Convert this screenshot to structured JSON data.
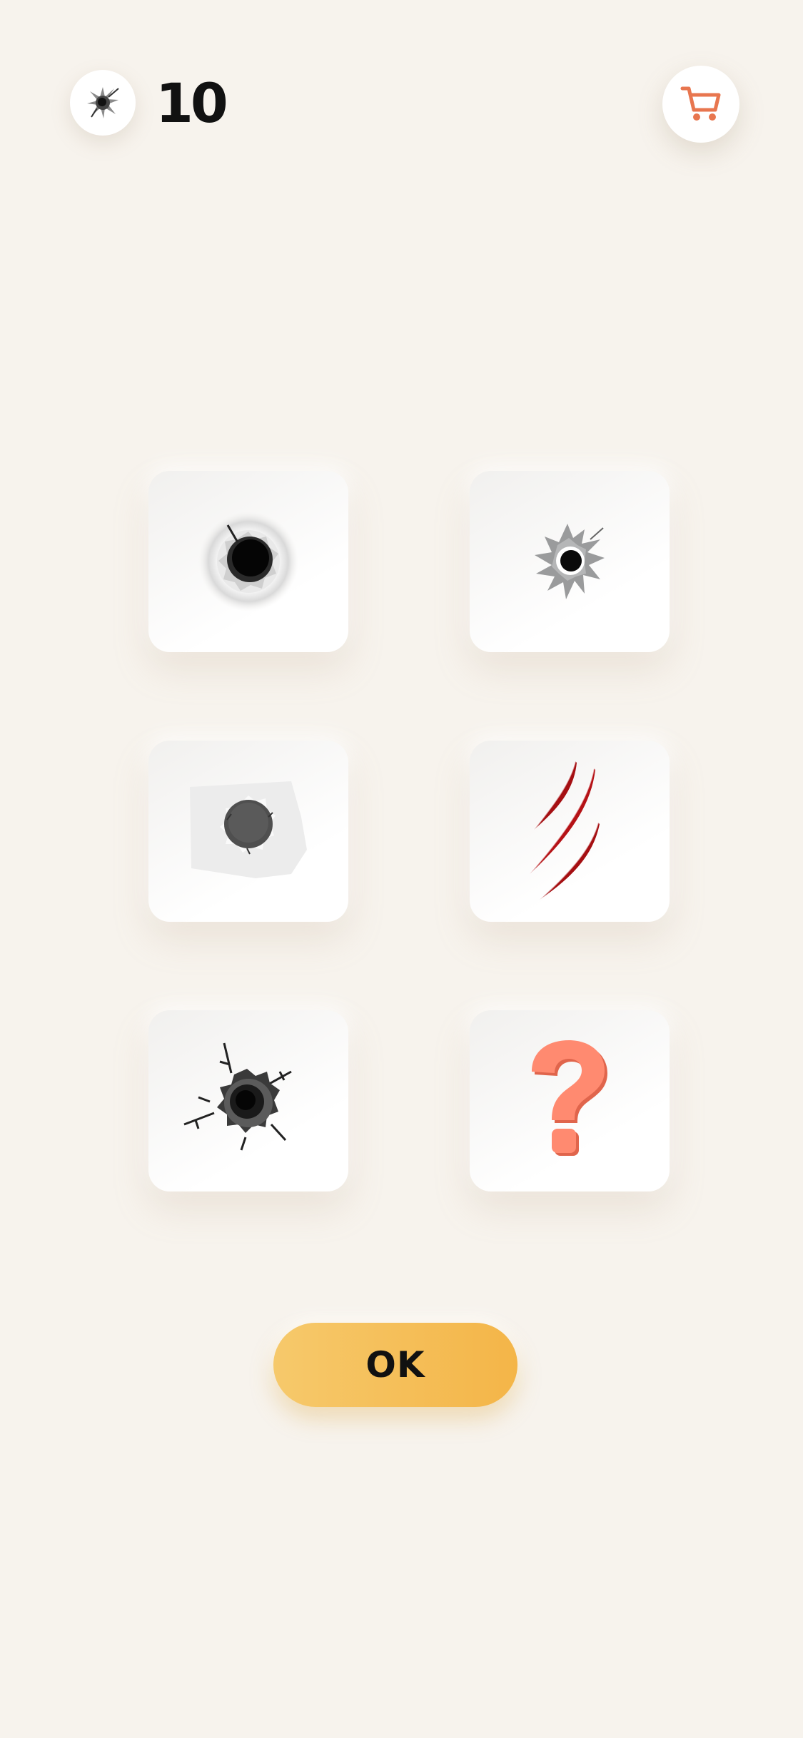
{
  "header": {
    "bullet_icon": "bullet-hole-icon",
    "count": "10",
    "cart_icon": "cart-icon",
    "cart_color": "#e8764f"
  },
  "skins": [
    {
      "id": "hole-black-round",
      "icon": "bullet-hole-icon"
    },
    {
      "id": "hole-gray-splash",
      "icon": "bullet-hole-gray-icon"
    },
    {
      "id": "hole-paper-torn",
      "icon": "paper-hole-icon"
    },
    {
      "id": "claw-scratch",
      "icon": "claw-scratch-icon"
    },
    {
      "id": "hole-cracked",
      "icon": "cracked-hole-icon"
    },
    {
      "id": "mystery",
      "icon": "question-mark-icon"
    }
  ],
  "ok_button": {
    "label": "OK",
    "color": "#f4b548"
  }
}
